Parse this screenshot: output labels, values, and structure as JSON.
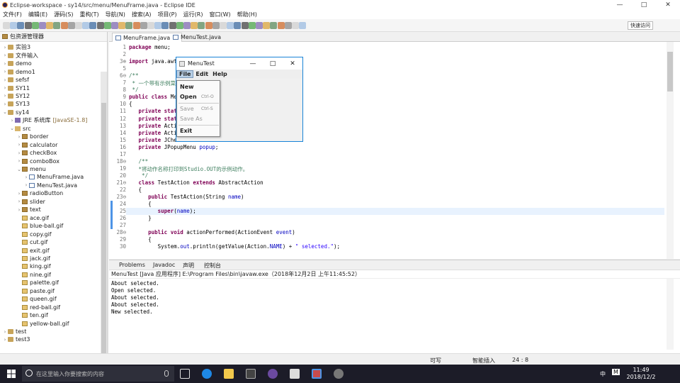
{
  "window": {
    "title": "Eclipse-workspace - sy14/src/menu/MenuFrame.java - Eclipse IDE",
    "controls": [
      "—",
      "□",
      "✕"
    ]
  },
  "menubar": [
    "文件(F)",
    "编辑(E)",
    "源码(S)",
    "重构(T)",
    "导航(N)",
    "搜索(A)",
    "项目(P)",
    "运行(R)",
    "窗口(W)",
    "帮助(H)"
  ],
  "quick_access": "快速访问",
  "left_panel": {
    "title": "包资源管理器",
    "tree": [
      {
        "label": "实验3",
        "indent": 0,
        "icon": "proj",
        "tw": "›"
      },
      {
        "label": "文件输入",
        "indent": 0,
        "icon": "proj",
        "tw": "›"
      },
      {
        "label": "demo",
        "indent": 0,
        "icon": "proj",
        "tw": "›"
      },
      {
        "label": "demo1",
        "indent": 0,
        "icon": "proj",
        "tw": "›"
      },
      {
        "label": "sefsf",
        "indent": 0,
        "icon": "proj",
        "tw": "›"
      },
      {
        "label": "SY11",
        "indent": 0,
        "icon": "proj",
        "tw": "›"
      },
      {
        "label": "SY12",
        "indent": 0,
        "icon": "proj",
        "tw": "›"
      },
      {
        "label": "SY13",
        "indent": 0,
        "icon": "proj",
        "tw": "›"
      },
      {
        "label": "sy14",
        "indent": 0,
        "icon": "proj",
        "tw": "⌄"
      },
      {
        "label": "JRE 系统库",
        "extra": "[JavaSE-1.8]",
        "indent": 1,
        "icon": "lib",
        "tw": "›"
      },
      {
        "label": "src",
        "indent": 1,
        "icon": "src",
        "tw": "⌄"
      },
      {
        "label": "border",
        "indent": 2,
        "icon": "pkg",
        "tw": "›"
      },
      {
        "label": "calculator",
        "indent": 2,
        "icon": "pkg",
        "tw": "›"
      },
      {
        "label": "checkBox",
        "indent": 2,
        "icon": "pkg",
        "tw": "›"
      },
      {
        "label": "comboBox",
        "indent": 2,
        "icon": "pkg",
        "tw": "›"
      },
      {
        "label": "menu",
        "indent": 2,
        "icon": "pkg",
        "tw": "⌄"
      },
      {
        "label": "MenuFrame.java",
        "indent": 3,
        "icon": "java",
        "tw": "›"
      },
      {
        "label": "MenuTest.java",
        "indent": 3,
        "icon": "java",
        "tw": "›"
      },
      {
        "label": "radioButton",
        "indent": 2,
        "icon": "pkg",
        "tw": "›"
      },
      {
        "label": "slider",
        "indent": 2,
        "icon": "pkg",
        "tw": "›"
      },
      {
        "label": "text",
        "indent": 2,
        "icon": "pkg",
        "tw": "›"
      },
      {
        "label": "ace.gif",
        "indent": 2,
        "icon": "gif",
        "tw": ""
      },
      {
        "label": "blue-ball.gif",
        "indent": 2,
        "icon": "gif",
        "tw": ""
      },
      {
        "label": "copy.gif",
        "indent": 2,
        "icon": "gif",
        "tw": ""
      },
      {
        "label": "cut.gif",
        "indent": 2,
        "icon": "gif",
        "tw": ""
      },
      {
        "label": "exit.gif",
        "indent": 2,
        "icon": "gif",
        "tw": ""
      },
      {
        "label": "jack.gif",
        "indent": 2,
        "icon": "gif",
        "tw": ""
      },
      {
        "label": "king.gif",
        "indent": 2,
        "icon": "gif",
        "tw": ""
      },
      {
        "label": "nine.gif",
        "indent": 2,
        "icon": "gif",
        "tw": ""
      },
      {
        "label": "palette.gif",
        "indent": 2,
        "icon": "gif",
        "tw": ""
      },
      {
        "label": "paste.gif",
        "indent": 2,
        "icon": "gif",
        "tw": ""
      },
      {
        "label": "queen.gif",
        "indent": 2,
        "icon": "gif",
        "tw": ""
      },
      {
        "label": "red-ball.gif",
        "indent": 2,
        "icon": "gif",
        "tw": ""
      },
      {
        "label": "ten.gif",
        "indent": 2,
        "icon": "gif",
        "tw": ""
      },
      {
        "label": "yellow-ball.gif",
        "indent": 2,
        "icon": "gif",
        "tw": ""
      },
      {
        "label": "test",
        "indent": 0,
        "icon": "proj",
        "tw": "›"
      },
      {
        "label": "test3",
        "indent": 0,
        "icon": "proj",
        "tw": "›"
      }
    ]
  },
  "editor": {
    "tabs": [
      {
        "label": "MenuFrame.java",
        "close": "✕",
        "active": true
      },
      {
        "label": "MenuTest.java",
        "close": "",
        "active": false
      }
    ],
    "lines": [
      {
        "n": "1",
        "html": "<span class='kw'>package</span> menu;"
      },
      {
        "n": "2",
        "html": ""
      },
      {
        "n": "3⊕",
        "html": "<span class='kw'>import</span> java.awt"
      },
      {
        "n": "5",
        "html": ""
      },
      {
        "n": "6⊖",
        "html": "<span class='cm'>/**</span>"
      },
      {
        "n": "7",
        "html": "<span class='cm'> * 一个带有示例菜单</span>"
      },
      {
        "n": "8",
        "html": "<span class='cm'> */</span>"
      },
      {
        "n": "9",
        "html": "<span class='kw'>public class</span> Me"
      },
      {
        "n": "10",
        "html": "{"
      },
      {
        "n": "11",
        "html": "   <span class='kw'>private</span> <span class='kw'>stat</span>"
      },
      {
        "n": "12",
        "html": "   <span class='kw'>private</span> <span class='kw'>stat</span>"
      },
      {
        "n": "13",
        "html": "   <span class='kw'>private</span> Acti"
      },
      {
        "n": "14",
        "html": "   <span class='kw'>private</span> Acti"
      },
      {
        "n": "15",
        "html": "   <span class='kw'>private</span> JChe"
      },
      {
        "n": "16",
        "html": "   <span class='kw'>private</span> JPopupMenu <span class='fld'>popup</span>;"
      },
      {
        "n": "17",
        "html": ""
      },
      {
        "n": "18⊖",
        "html": "   <span class='cm'>/**</span>"
      },
      {
        "n": "19",
        "html": "   <span class='cm'>*将动作名称打印到Studio.OUT的示例动作。</span>"
      },
      {
        "n": "20",
        "html": "   <span class='cm'> */</span>"
      },
      {
        "n": "21⊖",
        "html": "   <span class='kw'>class</span> TestAction <span class='kw'>extends</span> AbstractAction"
      },
      {
        "n": "22",
        "html": "   {"
      },
      {
        "n": "23⊖",
        "html": "      <span class='kw'>public</span> TestAction(String <span class='fld'>name</span>)"
      },
      {
        "n": "24",
        "html": "      {"
      },
      {
        "n": "25",
        "html": "         <span class='kw'>super</span>(<span class='fld'>name</span>);"
      },
      {
        "n": "26",
        "html": "      }"
      },
      {
        "n": "27",
        "html": ""
      },
      {
        "n": "28⊖",
        "html": "      <span class='kw'>public void</span> actionPerformed(ActionEvent <span class='fld'>event</span>)"
      },
      {
        "n": "29",
        "html": "      {"
      },
      {
        "n": "30",
        "html": "         System.<span class='fld'>out</span>.println(getValue(Action.<span class='fld'>NAME</span>) + <span class='str'>\" selected.\"</span>);"
      }
    ]
  },
  "menutest": {
    "title": "MenuTest",
    "menus": [
      "File",
      "Edit",
      "Help"
    ],
    "items": [
      {
        "label": "New",
        "accel": "",
        "enabled": true
      },
      {
        "label": "Open",
        "accel": "Ctrl-O",
        "enabled": true
      },
      {
        "label": "Save",
        "accel": "Ctrl-S",
        "enabled": false
      },
      {
        "label": "Save As",
        "accel": "",
        "enabled": false
      },
      {
        "label": "Exit",
        "accel": "",
        "enabled": true
      }
    ]
  },
  "console": {
    "tabs": [
      "Problems",
      "Javadoc",
      "声明",
      "控制台"
    ],
    "status": "MenuTest [Java 应用程序] E:\\Program Files\\bin\\javaw.exe（2018年12月2日 上午11:45:52）",
    "lines": [
      "About selected.",
      "Open selected.",
      "About selected.",
      "About selected.",
      "New selected."
    ]
  },
  "statusbar": {
    "writable": "可写",
    "insert_mode": "智能插入",
    "position": "24 : 8"
  },
  "taskbar": {
    "search_placeholder": "在这里输入你要搜索的内容",
    "time": "11:49",
    "date": "2018/12/2",
    "ime": "中",
    "notif": "M"
  }
}
